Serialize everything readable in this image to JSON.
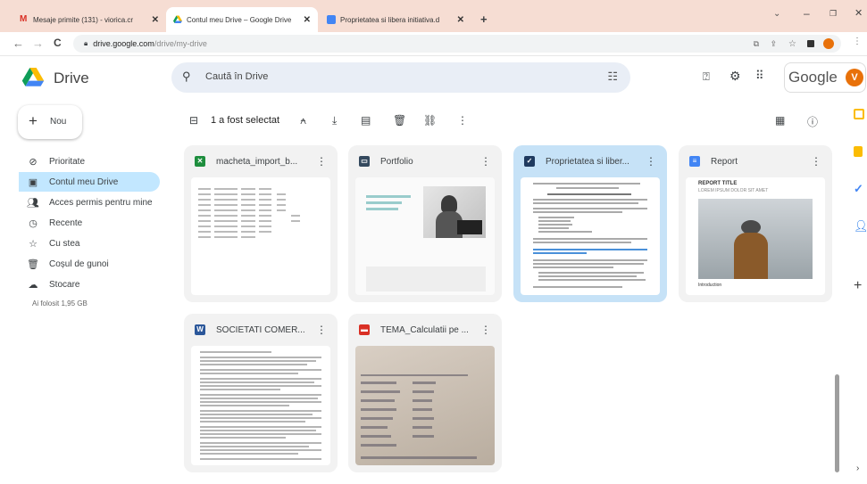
{
  "browser": {
    "tabs": [
      {
        "title": "Mesaje primite (131) - viorica.cr"
      },
      {
        "title": "Contul meu Drive – Google Drive"
      },
      {
        "title": "Proprietatea si libera initiativa.d"
      }
    ],
    "url_host": "drive.google.com",
    "url_path": "/drive/my-drive"
  },
  "header": {
    "app_name": "Drive",
    "search_placeholder": "Caută în Drive",
    "brand": "Google",
    "avatar_letter": "V"
  },
  "sidebar": {
    "new_label": "Nou",
    "items": [
      {
        "label": "Prioritate"
      },
      {
        "label": "Contul meu Drive"
      },
      {
        "label": "Acces permis pentru mine"
      },
      {
        "label": "Recente"
      },
      {
        "label": "Cu stea"
      },
      {
        "label": "Coșul de gunoi"
      },
      {
        "label": "Stocare"
      }
    ],
    "storage_used": "Ai folosit 1,95 GB"
  },
  "toolbar": {
    "selection_label": "1 a fost selectat"
  },
  "files": [
    {
      "name": "macheta_import_b...",
      "type": "sheets",
      "color": "#1e8e3e"
    },
    {
      "name": "Portfolio",
      "type": "slides",
      "color": "#34495e"
    },
    {
      "name": "Proprietatea si liber...",
      "type": "docs",
      "color": "#1f3a5f"
    },
    {
      "name": "Report",
      "type": "docs",
      "color": "#4285f4"
    },
    {
      "name": "SOCIETATI COMER...",
      "type": "word",
      "color": "#2b579a"
    },
    {
      "name": "TEMA_Calculatii pe ...",
      "type": "pdf",
      "color": "#d93025"
    }
  ],
  "thumbs": {
    "report_title": "REPORT TITLE",
    "report_sub": "LOREM IPSUM DOLOR SIT AMET",
    "report_intro": "Introduction"
  }
}
